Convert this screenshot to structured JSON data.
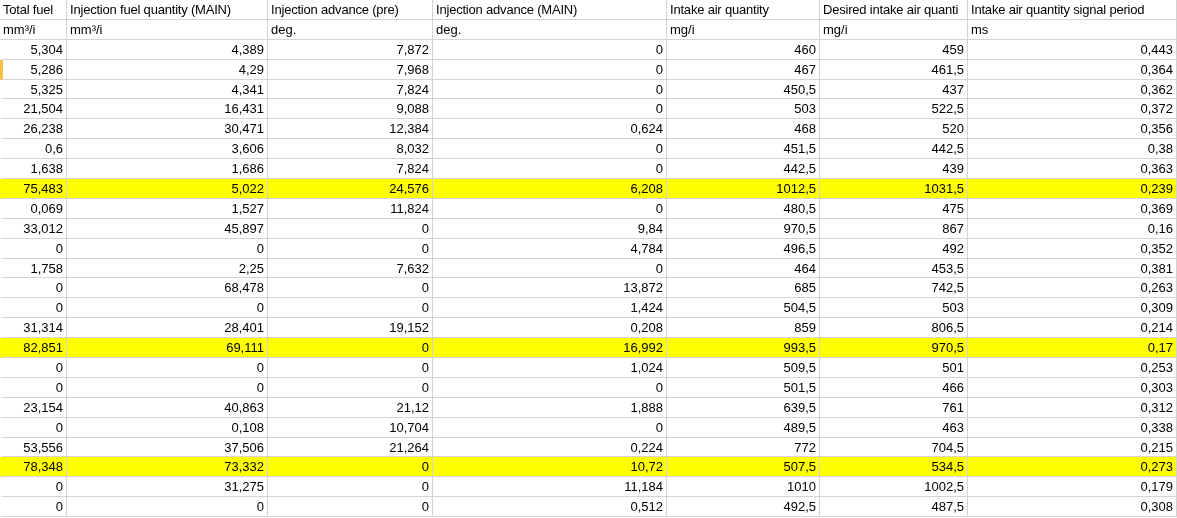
{
  "columns": [
    {
      "title": "Total fuel",
      "unit": "mm³/i"
    },
    {
      "title": "Injection fuel quantity (MAIN)",
      "unit": "mm³/i"
    },
    {
      "title": "Injection advance (pre)",
      "unit": "deg."
    },
    {
      "title": "Injection advance (MAIN)",
      "unit": "deg."
    },
    {
      "title": "Intake air quantity",
      "unit": "mg/i"
    },
    {
      "title": "Desired intake air quanti",
      "unit": "mg/i"
    },
    {
      "title": "Intake air quantity signal period",
      "unit": "ms"
    }
  ],
  "rows": [
    {
      "cells": [
        "5,304",
        "4,389",
        "7,872",
        "0",
        "460",
        "459",
        "0,443"
      ],
      "highlighted": false,
      "selected": false
    },
    {
      "cells": [
        "5,286",
        "4,29",
        "7,968",
        "0",
        "467",
        "461,5",
        "0,364"
      ],
      "highlighted": false,
      "selected": true
    },
    {
      "cells": [
        "5,325",
        "4,341",
        "7,824",
        "0",
        "450,5",
        "437",
        "0,362"
      ],
      "highlighted": false,
      "selected": false
    },
    {
      "cells": [
        "21,504",
        "16,431",
        "9,088",
        "0",
        "503",
        "522,5",
        "0,372"
      ],
      "highlighted": false,
      "selected": false
    },
    {
      "cells": [
        "26,238",
        "30,471",
        "12,384",
        "0,624",
        "468",
        "520",
        "0,356"
      ],
      "highlighted": false,
      "selected": false
    },
    {
      "cells": [
        "0,6",
        "3,606",
        "8,032",
        "0",
        "451,5",
        "442,5",
        "0,38"
      ],
      "highlighted": false,
      "selected": false
    },
    {
      "cells": [
        "1,638",
        "1,686",
        "7,824",
        "0",
        "442,5",
        "439",
        "0,363"
      ],
      "highlighted": false,
      "selected": false
    },
    {
      "cells": [
        "75,483",
        "5,022",
        "24,576",
        "6,208",
        "1012,5",
        "1031,5",
        "0,239"
      ],
      "highlighted": true,
      "selected": false
    },
    {
      "cells": [
        "0,069",
        "1,527",
        "11,824",
        "0",
        "480,5",
        "475",
        "0,369"
      ],
      "highlighted": false,
      "selected": false
    },
    {
      "cells": [
        "33,012",
        "45,897",
        "0",
        "9,84",
        "970,5",
        "867",
        "0,16"
      ],
      "highlighted": false,
      "selected": false
    },
    {
      "cells": [
        "0",
        "0",
        "0",
        "4,784",
        "496,5",
        "492",
        "0,352"
      ],
      "highlighted": false,
      "selected": false
    },
    {
      "cells": [
        "1,758",
        "2,25",
        "7,632",
        "0",
        "464",
        "453,5",
        "0,381"
      ],
      "highlighted": false,
      "selected": false
    },
    {
      "cells": [
        "0",
        "68,478",
        "0",
        "13,872",
        "685",
        "742,5",
        "0,263"
      ],
      "highlighted": false,
      "selected": false
    },
    {
      "cells": [
        "0",
        "0",
        "0",
        "1,424",
        "504,5",
        "503",
        "0,309"
      ],
      "highlighted": false,
      "selected": false
    },
    {
      "cells": [
        "31,314",
        "28,401",
        "19,152",
        "0,208",
        "859",
        "806,5",
        "0,214"
      ],
      "highlighted": false,
      "selected": false
    },
    {
      "cells": [
        "82,851",
        "69,111",
        "0",
        "16,992",
        "993,5",
        "970,5",
        "0,17"
      ],
      "highlighted": true,
      "selected": false
    },
    {
      "cells": [
        "0",
        "0",
        "0",
        "1,024",
        "509,5",
        "501",
        "0,253"
      ],
      "highlighted": false,
      "selected": false
    },
    {
      "cells": [
        "0",
        "0",
        "0",
        "0",
        "501,5",
        "466",
        "0,303"
      ],
      "highlighted": false,
      "selected": false
    },
    {
      "cells": [
        "23,154",
        "40,863",
        "21,12",
        "1,888",
        "639,5",
        "761",
        "0,312"
      ],
      "highlighted": false,
      "selected": false
    },
    {
      "cells": [
        "0",
        "0,108",
        "10,704",
        "0",
        "489,5",
        "463",
        "0,338"
      ],
      "highlighted": false,
      "selected": false
    },
    {
      "cells": [
        "53,556",
        "37,506",
        "21,264",
        "0,224",
        "772",
        "704,5",
        "0,215"
      ],
      "highlighted": false,
      "selected": false
    },
    {
      "cells": [
        "78,348",
        "73,332",
        "0",
        "10,72",
        "507,5",
        "534,5",
        "0,273"
      ],
      "highlighted": true,
      "selected": false
    },
    {
      "cells": [
        "0",
        "31,275",
        "0",
        "11,184",
        "1010",
        "1002,5",
        "0,179"
      ],
      "highlighted": false,
      "selected": false
    },
    {
      "cells": [
        "0",
        "0",
        "0",
        "0,512",
        "492,5",
        "487,5",
        "0,308"
      ],
      "highlighted": false,
      "selected": false
    }
  ]
}
